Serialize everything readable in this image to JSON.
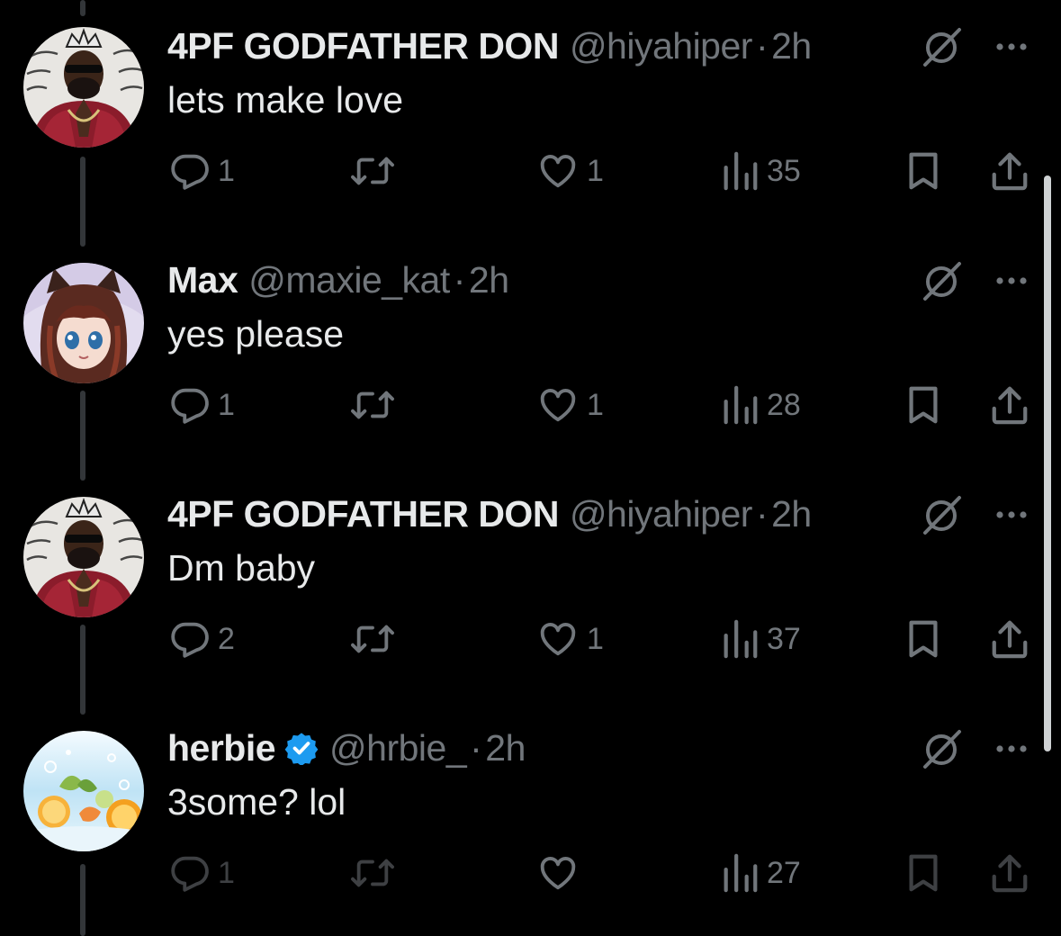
{
  "colors": {
    "background": "#000000",
    "primary_text": "#e7e9ea",
    "secondary_text": "#71767b",
    "thread_line": "#333639",
    "verified_badge": "#1d9bf0"
  },
  "icons": {
    "reply": "speech-bubble-icon",
    "repost": "repost-arrows-icon",
    "like": "heart-icon",
    "views": "bar-chart-icon",
    "bookmark": "bookmark-icon",
    "share": "share-upload-icon",
    "grok": "grok-slash-circle-icon",
    "more": "more-dots-icon"
  },
  "tweets": [
    {
      "name": "4PF GODFATHER DON",
      "handle": "@hiyahiper",
      "separator": "·",
      "time": "2h",
      "text": "lets make love",
      "verified": false,
      "reply_count": "1",
      "like_count": "1",
      "view_count": "35"
    },
    {
      "name": "Max",
      "handle": "@maxie_kat",
      "separator": "·",
      "time": "2h",
      "text": "yes please",
      "verified": false,
      "reply_count": "1",
      "like_count": "1",
      "view_count": "28"
    },
    {
      "name": "4PF GODFATHER DON",
      "handle": "@hiyahiper",
      "separator": "·",
      "time": "2h",
      "text": "Dm baby",
      "verified": false,
      "reply_count": "2",
      "like_count": "1",
      "view_count": "37"
    },
    {
      "name": "herbie",
      "handle": "@hrbie_",
      "separator": "·",
      "time": "2h",
      "text": "3some? lol",
      "verified": true,
      "reply_count": "1",
      "like_count": "",
      "view_count": "27"
    }
  ]
}
